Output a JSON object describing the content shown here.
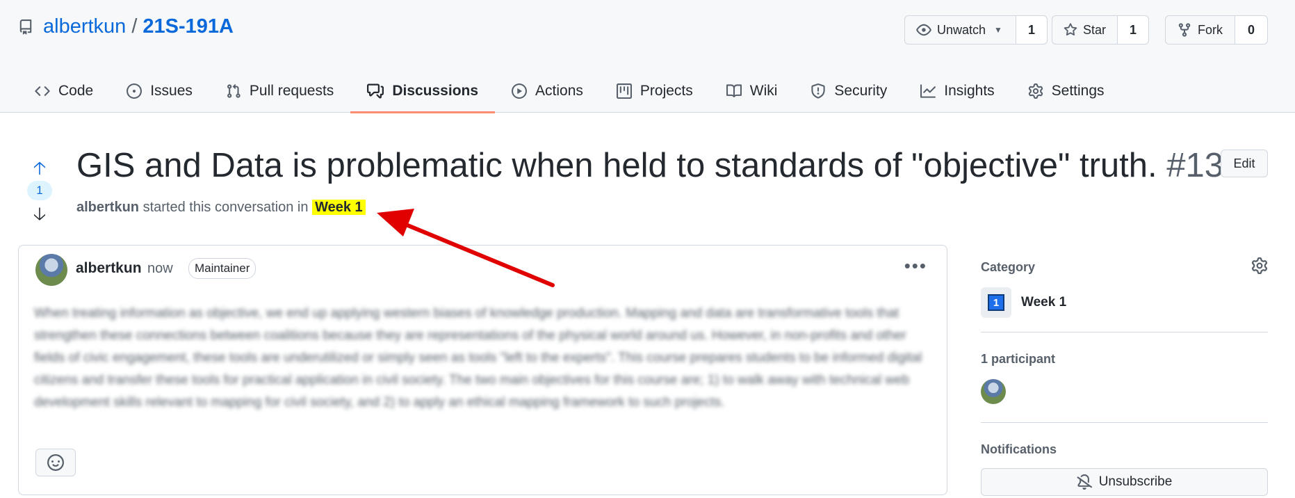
{
  "repo": {
    "owner": "albertkun",
    "separator": "/",
    "name": "21S-191A"
  },
  "actions": {
    "watch": {
      "label": "Unwatch",
      "count": "1"
    },
    "star": {
      "label": "Star",
      "count": "1"
    },
    "fork": {
      "label": "Fork",
      "count": "0"
    }
  },
  "tabs": [
    {
      "label": "Code",
      "icon": "code-icon"
    },
    {
      "label": "Issues",
      "icon": "issue-icon"
    },
    {
      "label": "Pull requests",
      "icon": "pull-request-icon"
    },
    {
      "label": "Discussions",
      "icon": "comment-discussion-icon",
      "active": true
    },
    {
      "label": "Actions",
      "icon": "play-icon"
    },
    {
      "label": "Projects",
      "icon": "project-icon"
    },
    {
      "label": "Wiki",
      "icon": "book-icon"
    },
    {
      "label": "Security",
      "icon": "shield-icon"
    },
    {
      "label": "Insights",
      "icon": "graph-icon"
    },
    {
      "label": "Settings",
      "icon": "gear-icon"
    }
  ],
  "discussion": {
    "title": "GIS and Data is problematic when held to standards of \"objective\" truth.",
    "number": "#13",
    "edit_label": "Edit",
    "votes": "1",
    "author": "albertkun",
    "started_text": "started this conversation in",
    "category": "Week 1"
  },
  "comment": {
    "author": "albertkun",
    "time": "now",
    "badge": "Maintainer",
    "body": "When treating information as objective, we end up applying western biases of knowledge production. Mapping and data are transformative tools that strengthen these connections between coalitions because they are representations of the physical world around us. However, in non-profits and other fields of civic engagement, these tools are underutilized or simply seen as tools \"left to the experts\". This course prepares students to be informed digital citizens and transfer these tools for practical application in civil society. The two main objectives for this course are; 1) to walk away with technical web development skills relevant to mapping for civil society, and 2) to apply an ethical mapping framework to such projects."
  },
  "sidebar": {
    "category_label": "Category",
    "category_name": "Week 1",
    "category_emoji": "1",
    "participants_label": "1 participant",
    "notifications_label": "Notifications",
    "unsubscribe_label": "Unsubscribe"
  },
  "colors": {
    "link": "#0969da",
    "tab_underline": "#fd8c73",
    "highlight": "#ffff00",
    "annotation_arrow": "#e00000"
  }
}
